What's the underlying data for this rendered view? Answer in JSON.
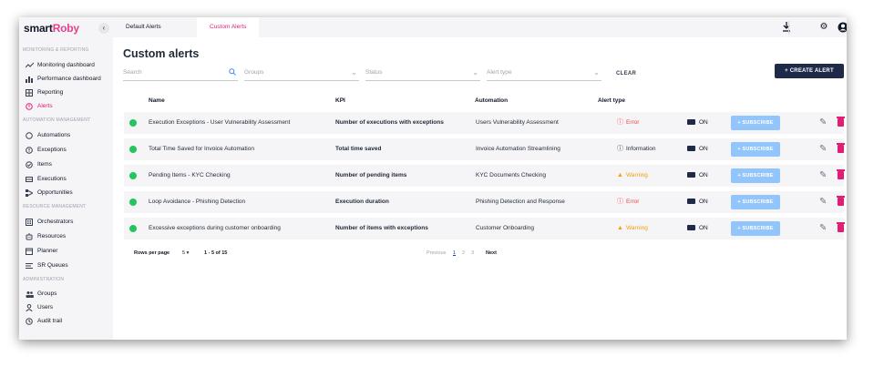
{
  "app": {
    "logo_text": "smartRoby",
    "logo_main": "smart",
    "logo_accent": "Roby"
  },
  "sidebar": {
    "sections": [
      {
        "label": "MONITORING & REPORTING"
      },
      {
        "label": "AUTOMATION MANAGEMENT"
      },
      {
        "label": "RESOURCE MANAGEMENT"
      },
      {
        "label": "ADMINISTRATION"
      }
    ],
    "items": [
      {
        "label": "Monitoring dashboard",
        "icon": "trend-line-icon"
      },
      {
        "label": "Performance dashboard",
        "icon": "bar-chart-icon"
      },
      {
        "label": "Reporting",
        "icon": "report-grid-icon"
      },
      {
        "label": "Alerts",
        "icon": "alert-icon"
      },
      {
        "label": "Automations",
        "icon": "circle-icon"
      },
      {
        "label": "Exceptions",
        "icon": "exception-icon"
      },
      {
        "label": "Items",
        "icon": "check-circle-icon"
      },
      {
        "label": "Executions",
        "icon": "executions-icon"
      },
      {
        "label": "Opportunities",
        "icon": "opportunities-icon"
      },
      {
        "label": "Orchestrators",
        "icon": "orchestrator-icon"
      },
      {
        "label": "Resources",
        "icon": "robot-icon"
      },
      {
        "label": "Planner",
        "icon": "calendar-icon"
      },
      {
        "label": "SR Queues",
        "icon": "queue-icon"
      },
      {
        "label": "Groups",
        "icon": "groups-icon"
      },
      {
        "label": "Users",
        "icon": "user-icon"
      },
      {
        "label": "Audit trail",
        "icon": "history-icon"
      }
    ],
    "active_item": "Alerts"
  },
  "header": {
    "tabs": [
      {
        "label": "Default Alerts"
      },
      {
        "label": "Custom Alerts"
      }
    ],
    "active_tab": "Custom Alerts"
  },
  "page": {
    "title": "Custom alerts",
    "filters": {
      "search_placeholder": "Search",
      "groups_placeholder": "Groups",
      "status_placeholder": "Status",
      "alert_type_placeholder": "Alert type"
    },
    "clear_label": "CLEAR",
    "create_label": "CREATE ALERT"
  },
  "table": {
    "columns": [
      "Name",
      "KPI",
      "Automation",
      "Alert type"
    ],
    "rows": [
      {
        "name": "Execution Exceptions - User Vulnerability Assessment",
        "kpi": "Number of executions with exceptions",
        "automation": "Users Vulnerability Assessment",
        "alert_type": "Error",
        "notify": "ON",
        "subscribe": "SUBSCRIBE"
      },
      {
        "name": "Total Time Saved for Invoice Automation",
        "kpi": "Total time saved",
        "automation": "Invoice Automation Streamlining",
        "alert_type": "Information",
        "notify": "ON",
        "subscribe": "SUBSCRIBE"
      },
      {
        "name": "Pending Items - KYC Checking",
        "kpi": "Number of pending items",
        "automation": "KYC Documents Checking",
        "alert_type": "Warning",
        "notify": "ON",
        "subscribe": "SUBSCRIBE"
      },
      {
        "name": "Loop Avoidance - Phishing Detection",
        "kpi": "Execution duration",
        "automation": "Phishing Detection and Response",
        "alert_type": "Error",
        "notify": "ON",
        "subscribe": "SUBSCRIBE"
      },
      {
        "name": "Excessive exceptions during customer onboarding",
        "kpi": "Number of items with exceptions",
        "automation": "Customer Onboarding",
        "alert_type": "Warning",
        "notify": "ON",
        "subscribe": "SUBSCRIBE"
      }
    ]
  },
  "pagination": {
    "rows_per_page_label": "Rows per page",
    "rows_per_page_value": "5",
    "range": "1 - 5 of 15",
    "previous": "Previous",
    "pages": [
      "1",
      "2",
      "3"
    ],
    "current_page": "1",
    "next": "Next"
  },
  "colors": {
    "accent": "#e11d74",
    "navy": "#1e2a47",
    "error": "#ef4444",
    "warning": "#f59e0b",
    "status_active": "#22c55e",
    "subscribe": "#93c5fd"
  }
}
